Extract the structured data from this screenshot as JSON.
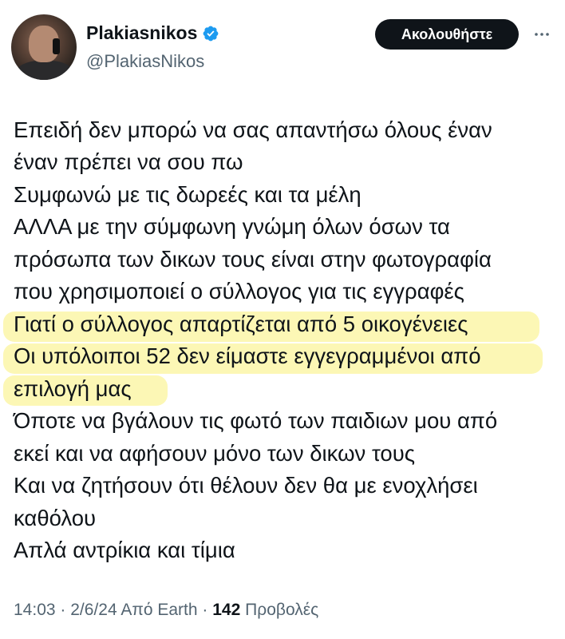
{
  "author": {
    "display_name": "Plakiasnikos",
    "handle": "@PlakiasNikos",
    "verified": true,
    "avatar_description": "profile-photo"
  },
  "actions": {
    "follow_label": "Ακολουθήστε",
    "more_icon": "more-horizontal-icon"
  },
  "tweet": {
    "lines": [
      "Επειδή δεν μπορώ να σας απαντήσω όλους έναν",
      "έναν πρέπει να σου πω",
      "Συμφωνώ με τις δωρεές και τα μέλη",
      "ΑΛΛΑ με την σύμφωνη γνώμη όλων όσων τα",
      "πρόσωπα των δικων τους είναι στην φωτογραφία",
      "που χρησιμοποιεί ο σύλλογος για τις εγγραφές",
      "Γιατί ο σύλλογος απαρτίζεται από 5 οικογένειες",
      "Οι υπόλοιποι 52 δεν είμαστε εγγεγραμμένοι από",
      "επιλογή μας",
      "Όποτε να βγάλουν τις φωτό των παιδιων μου από",
      "εκεί και να αφήσουν μόνο των δικων τους",
      "Και να ζητήσουν ότι θέλουν δεν θα με ενοχλήσει",
      "καθόλου",
      "Απλά αντρίκια και τίμια"
    ],
    "highlight_color": "#faf078"
  },
  "meta": {
    "time": "14:03",
    "separator": "·",
    "date": "2/6/24",
    "source": "Από Earth",
    "views_count": "142",
    "views_label": "Προβολές"
  },
  "colors": {
    "text": "#0f1419",
    "secondary": "#536471",
    "verified": "#1d9bf0",
    "follow_bg": "#0f1419"
  }
}
